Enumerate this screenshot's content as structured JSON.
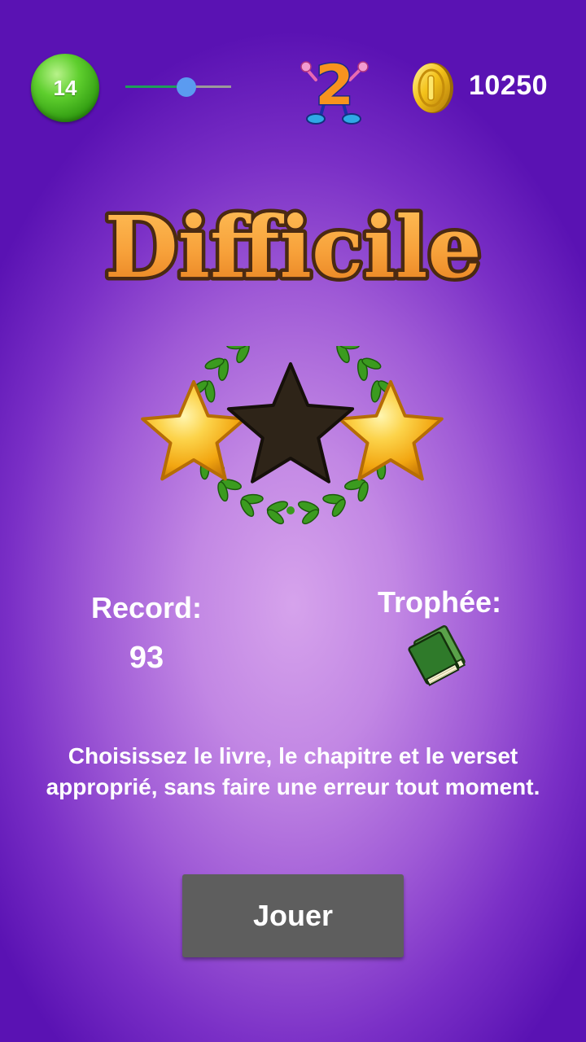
{
  "top_bar": {
    "level": "14",
    "slider_level_fraction": 0.58,
    "level_number_icon": "number-two-mascot-icon",
    "coin_icon": "gold-coin-icon",
    "coins": "10250"
  },
  "title": {
    "text": "Difficile"
  },
  "stars": {
    "earned": 2,
    "total": 3,
    "filled_pattern": [
      true,
      false,
      true
    ],
    "filled_color": "#f6b81c",
    "empty_color": "#2e2418",
    "wreath_color": "#3b9b1f"
  },
  "stats": {
    "record_label": "Record:",
    "record_value": "93",
    "trophy_label": "Trophée:",
    "trophy_icon": "green-book-icon"
  },
  "description": "Choisissez le livre, le chapitre et le verset approprié, sans faire une erreur tout moment.",
  "play_button_label": "Jouer",
  "colors": {
    "background_center": "#d6a3ec",
    "background_edge": "#5a12b3",
    "level_badge": "#3fae18",
    "slider_thumb": "#5b9bf0",
    "slider_fill": "#1f9d5a",
    "title_fill": "#f7a13a",
    "button_bg": "#5e5e5e"
  }
}
